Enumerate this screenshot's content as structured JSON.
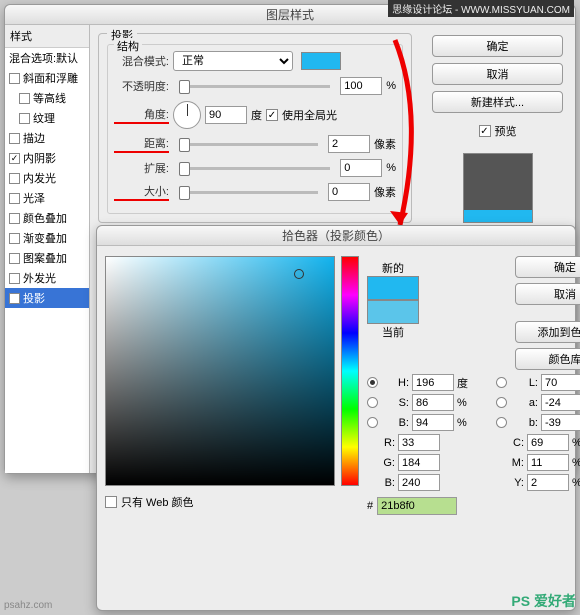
{
  "watermarks": {
    "top": "思缘设计论坛 - WWW.MISSYUAN.COM",
    "bottom": "PS 爱好者",
    "bottomLeft": "psahz.com"
  },
  "layerStyle": {
    "title": "图层样式",
    "stylesHeader": "样式",
    "blendDefault": "混合选项:默认",
    "items": [
      {
        "label": "斜面和浮雕",
        "checked": false
      },
      {
        "label": "等高线",
        "checked": false,
        "indent": 1
      },
      {
        "label": "纹理",
        "checked": false,
        "indent": 1
      },
      {
        "label": "描边",
        "checked": false
      },
      {
        "label": "内阴影",
        "checked": true
      },
      {
        "label": "内发光",
        "checked": false
      },
      {
        "label": "光泽",
        "checked": false
      },
      {
        "label": "颜色叠加",
        "checked": false
      },
      {
        "label": "渐变叠加",
        "checked": false
      },
      {
        "label": "图案叠加",
        "checked": false
      },
      {
        "label": "外发光",
        "checked": false
      },
      {
        "label": "投影",
        "checked": true,
        "selected": true
      }
    ],
    "section": "投影",
    "struct": "结构",
    "blendMode": "混合模式:",
    "blendValue": "正常",
    "opacity": "不透明度:",
    "opacityVal": "100",
    "angle": "角度:",
    "angleVal": "90",
    "deg": "度",
    "globalLight": "使用全局光",
    "distance": "距离:",
    "distanceVal": "2",
    "px": "像素",
    "spread": "扩展:",
    "spreadVal": "0",
    "pct": "%",
    "size": "大小:",
    "sizeVal": "0",
    "swatch": "#21b8f0",
    "buttons": {
      "ok": "确定",
      "cancel": "取消",
      "newStyle": "新建样式...",
      "preview": "预览"
    }
  },
  "picker": {
    "title": "拾色器（投影颜色）",
    "new": "新的",
    "current": "当前",
    "newColor": "#21b8f0",
    "currentColor": "#5bc5ea",
    "ok": "确定",
    "cancel": "取消",
    "addSwatch": "添加到色板",
    "colorLib": "颜色库",
    "webOnly": "只有 Web 颜色",
    "H": "196",
    "S": "86",
    "B": "94",
    "R": "33",
    "G": "184",
    "Bb": "240",
    "L": "70",
    "a": "-24",
    "b": "-39",
    "C": "69",
    "M": "11",
    "Y": "2",
    "Hl": "H:",
    "Sl": "S:",
    "Bl": "B:",
    "Rl": "R:",
    "Gl": "G:",
    "Bbl": "B:",
    "Ll": "L:",
    "al": "a:",
    "bl": "b:",
    "Cl": "C:",
    "Ml": "M:",
    "Yl": "Y:",
    "degU": "度",
    "pctU": "%",
    "hex": "21b8f0",
    "hash": "#"
  }
}
